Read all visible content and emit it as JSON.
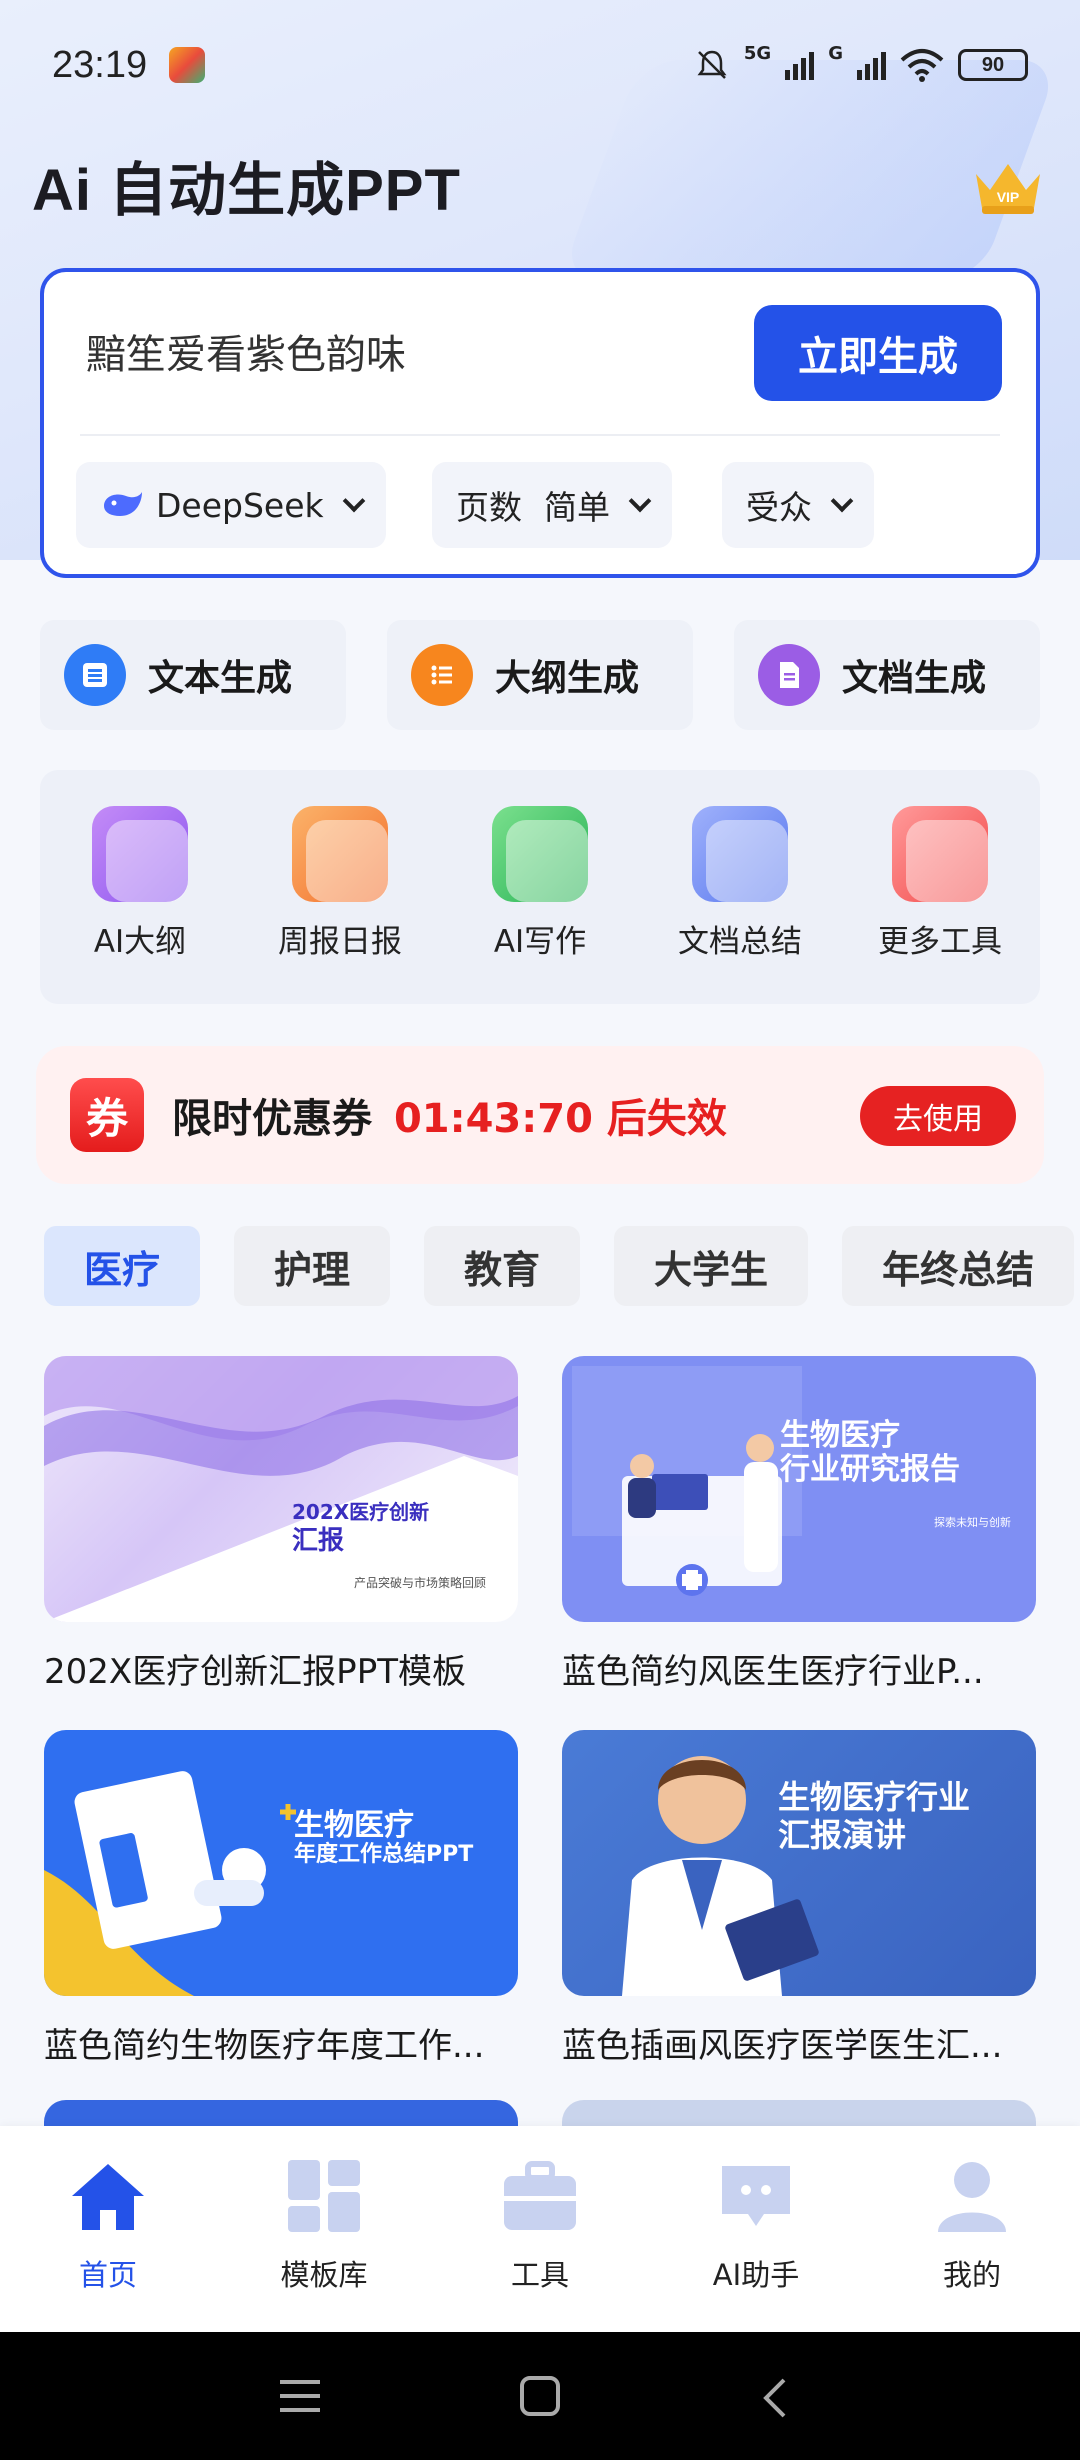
{
  "status_bar": {
    "time": "23:19",
    "network_1": "5G",
    "network_2": "G",
    "battery": "90"
  },
  "header": {
    "logo": "Ai 自动生成PPT",
    "vip_badge": "VIP"
  },
  "input_card": {
    "text": "黯笙爱看紫色韵味",
    "generate_button": "立即生成",
    "model_option": "DeepSeek",
    "pages_label": "页数",
    "pages_value": "简单",
    "audience_label": "受众"
  },
  "generation_tabs": [
    {
      "label": "文本生成",
      "color": "#2f7cf6"
    },
    {
      "label": "大纲生成",
      "color": "#f7861e"
    },
    {
      "label": "文档生成",
      "color": "#9b5de5"
    }
  ],
  "tools": [
    {
      "label": "AI大纲",
      "icon": "outline-icon",
      "color": "#a56cf0"
    },
    {
      "label": "周报日报",
      "icon": "calendar-icon",
      "color": "#f78c3b"
    },
    {
      "label": "AI写作",
      "icon": "pencil-icon",
      "color": "#3cc36a"
    },
    {
      "label": "文档总结",
      "icon": "document-icon",
      "color": "#6d86f2"
    },
    {
      "label": "更多工具",
      "icon": "more-icon",
      "color": "#f35b5b"
    }
  ],
  "coupon": {
    "badge": "券",
    "text": "限时优惠券",
    "timer": "01:43:70 后失效",
    "button": "去使用"
  },
  "categories": [
    "医疗",
    "护理",
    "教育",
    "大学生",
    "年终总结"
  ],
  "templates": [
    {
      "title": "202X医疗创新汇报PPT模板",
      "thumb_title": "202X医疗创新",
      "thumb_title_2": "汇报",
      "thumb_sub": "产品突破与市场策略回顾"
    },
    {
      "title": "蓝色简约风医生医疗行业P...",
      "thumb_title": "生物医疗",
      "thumb_title_2": "行业研究报告",
      "thumb_sub": "探索未知与创新"
    },
    {
      "title": "蓝色简约生物医疗年度工作...",
      "thumb_title": "生物医疗",
      "thumb_title_2": "年度工作总结PPT",
      "thumb_sub": ""
    },
    {
      "title": "蓝色插画风医疗医学医生汇...",
      "thumb_title": "生物医疗行业",
      "thumb_title_2": "汇报演讲",
      "thumb_sub": ""
    }
  ],
  "bottom_nav": [
    {
      "label": "首页",
      "active": true
    },
    {
      "label": "模板库",
      "active": false
    },
    {
      "label": "工具",
      "active": false
    },
    {
      "label": "AI助手",
      "active": false
    },
    {
      "label": "我的",
      "active": false
    }
  ],
  "colors": {
    "primary": "#2452e8",
    "coupon_red": "#e62020",
    "nav_inactive": "#c8d2f0"
  }
}
